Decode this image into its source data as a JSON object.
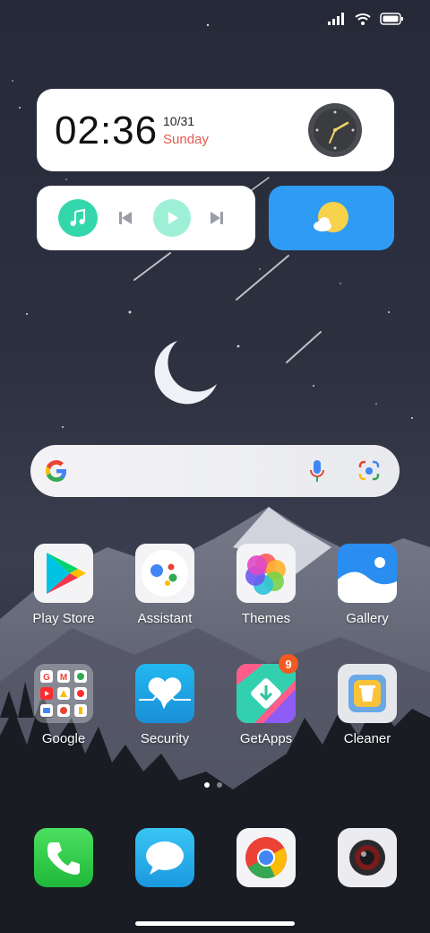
{
  "clock_widget": {
    "time": "02:36",
    "date": "10/31",
    "day": "Sunday"
  },
  "apps_row1": [
    {
      "label": "Play Store"
    },
    {
      "label": "Assistant"
    },
    {
      "label": "Themes"
    },
    {
      "label": "Gallery"
    }
  ],
  "apps_row2": [
    {
      "label": "Google"
    },
    {
      "label": "Security"
    },
    {
      "label": "GetApps",
      "badge": "9"
    },
    {
      "label": "Cleaner"
    }
  ],
  "colors": {
    "music_accent": "#34d7ab",
    "weather_bg": "#2e9cf5",
    "day_text": "#e05a4f",
    "badge": "#f25a21"
  }
}
